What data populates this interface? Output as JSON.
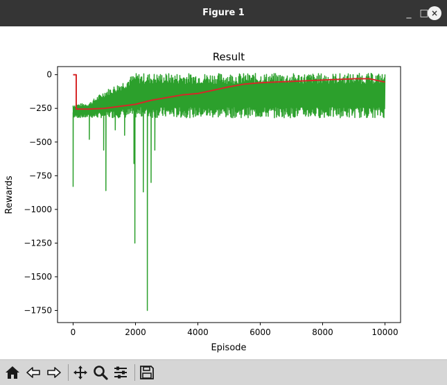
{
  "window": {
    "title": "Figure 1",
    "buttons": {
      "minimize": "_",
      "maximize": "□",
      "close": "×"
    }
  },
  "toolbar": {
    "icons": [
      "home-icon",
      "back-icon",
      "forward-icon",
      "pan-icon",
      "zoom-icon",
      "configure-subplots-icon",
      "save-icon"
    ]
  },
  "colors": {
    "titlebar": "#353535",
    "toolbar": "#d6d6d6",
    "raw_series": "#2ca02c",
    "avg_series": "#d62728"
  },
  "chart_data": {
    "type": "line",
    "title": "Result",
    "xlabel": "Episode",
    "ylabel": "Rewards",
    "xlim": [
      -500,
      10500
    ],
    "ylim": [
      -1840,
      60
    ],
    "xticks": [
      0,
      2000,
      4000,
      6000,
      8000,
      10000
    ],
    "xtick_labels": [
      "0",
      "2000",
      "4000",
      "6000",
      "8000",
      "10000"
    ],
    "yticks": [
      0,
      -250,
      -500,
      -750,
      -1000,
      -1250,
      -1500,
      -1750
    ],
    "ytick_labels": [
      "0",
      "−250",
      "−500",
      "−750",
      "−1000",
      "−1250",
      "−1500",
      "−1750"
    ],
    "grid": false,
    "series": [
      {
        "style": "noisy-band",
        "color": "#2ca02c",
        "x": [
          0,
          500,
          1000,
          1500,
          2000,
          2500,
          3000,
          3500,
          4000,
          4500,
          5000,
          5500,
          6000,
          6500,
          7000,
          7500,
          8000,
          8500,
          9000,
          9500,
          10000
        ],
        "upper": [
          -220,
          -210,
          -120,
          -60,
          10,
          10,
          10,
          10,
          10,
          10,
          10,
          10,
          10,
          10,
          10,
          10,
          10,
          10,
          10,
          10,
          10
        ],
        "lower": [
          -320,
          -320,
          -320,
          -320,
          -320,
          -320,
          -320,
          -320,
          -320,
          -320,
          -320,
          -320,
          -320,
          -320,
          -320,
          -320,
          -320,
          -320,
          -320,
          -320,
          -320
        ],
        "spikes": [
          {
            "x": 0,
            "y": -830
          },
          {
            "x": 520,
            "y": -480
          },
          {
            "x": 980,
            "y": -560
          },
          {
            "x": 1050,
            "y": -860
          },
          {
            "x": 1350,
            "y": -410
          },
          {
            "x": 1650,
            "y": -450
          },
          {
            "x": 1950,
            "y": -660
          },
          {
            "x": 1980,
            "y": -1250
          },
          {
            "x": 2250,
            "y": -870
          },
          {
            "x": 2380,
            "y": -1750
          },
          {
            "x": 2500,
            "y": -800
          },
          {
            "x": 2620,
            "y": -560
          }
        ]
      },
      {
        "style": "line",
        "color": "#d62728",
        "x": [
          0,
          100,
          100,
          500,
          1000,
          1500,
          2000,
          2500,
          3000,
          3500,
          4000,
          4500,
          5000,
          5500,
          6000,
          6500,
          7000,
          7500,
          8000,
          8500,
          9000,
          9500,
          10000
        ],
        "y": [
          0,
          0,
          -255,
          -255,
          -250,
          -235,
          -220,
          -190,
          -170,
          -150,
          -140,
          -115,
          -90,
          -70,
          -60,
          -55,
          -50,
          -45,
          -40,
          -35,
          -30,
          -30,
          -55
        ]
      }
    ]
  }
}
